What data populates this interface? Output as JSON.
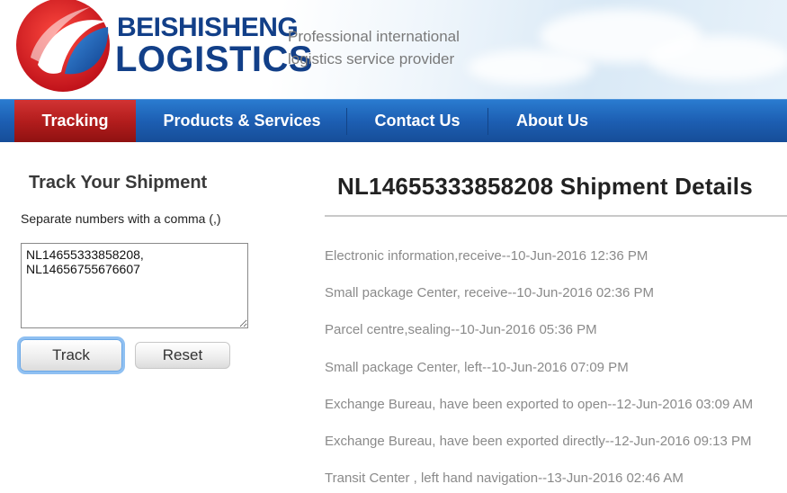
{
  "brand": {
    "name_top": "BEISHISHENG",
    "name_bottom": "LOGISTICS",
    "tagline_line1": "Professional international",
    "tagline_line2": "logistics service provider",
    "colors": {
      "brand_blue": "#123f88",
      "logo_red": "#d7191f",
      "logo_blue": "#1a5fb4"
    }
  },
  "nav": {
    "items": [
      {
        "label": "Tracking",
        "active": true
      },
      {
        "label": "Products & Services",
        "active": false
      },
      {
        "label": "Contact Us",
        "active": false
      },
      {
        "label": "About Us",
        "active": false
      }
    ],
    "colors": {
      "bar": "#1d5fb3",
      "active": "#b31d1d"
    }
  },
  "tracker": {
    "title": "Track Your Shipment",
    "hint": "Separate numbers with a comma (,)",
    "input_value": "NL14655333858208,\nNL14656755676607",
    "track_label": "Track",
    "reset_label": "Reset"
  },
  "details": {
    "title": "NL14655333858208 Shipment Details",
    "events": [
      "Electronic information,receive--10-Jun-2016 12:36 PM",
      "Small package Center, receive--10-Jun-2016 02:36 PM",
      "Parcel centre,sealing--10-Jun-2016 05:36 PM",
      "Small package Center, left--10-Jun-2016 07:09 PM",
      "Exchange Bureau, have been exported to open--12-Jun-2016 03:09 AM",
      "Exchange Bureau, have been exported directly--12-Jun-2016 09:13 PM",
      "Transit Center , left hand navigation--13-Jun-2016 02:46 AM"
    ]
  }
}
